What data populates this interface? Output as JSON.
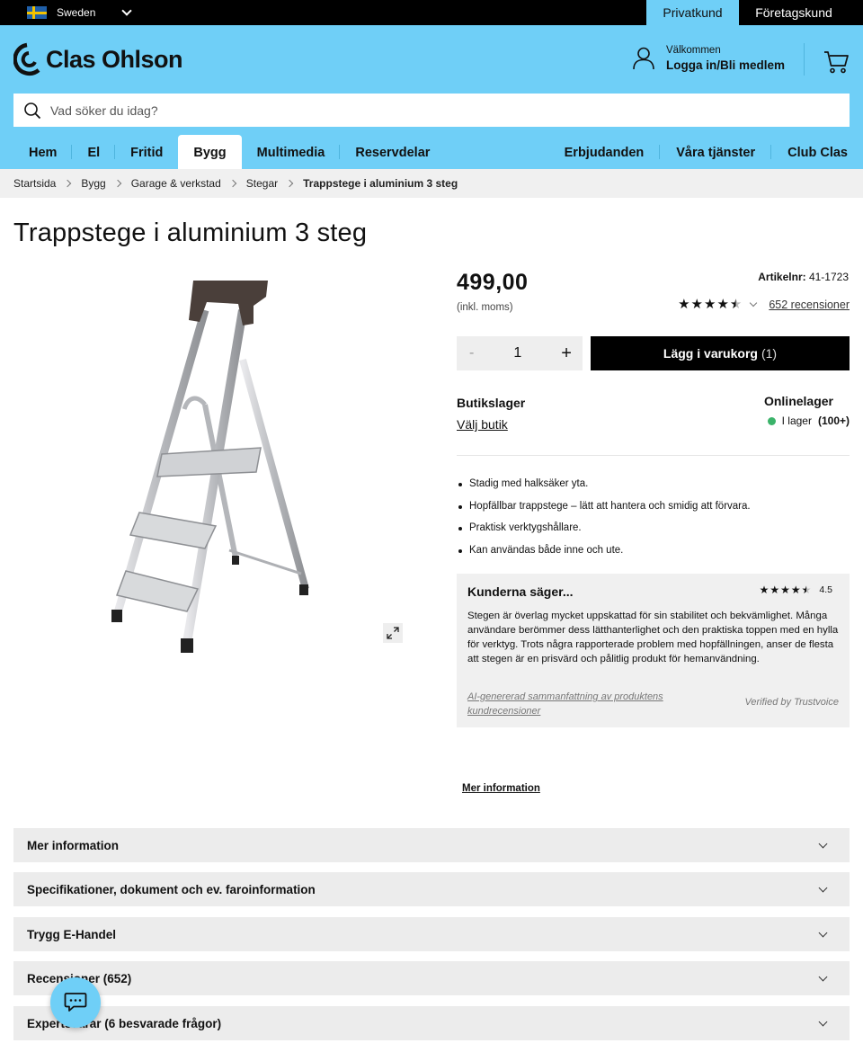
{
  "topbar": {
    "region": "Sweden",
    "private": "Privatkund",
    "business": "Företagskund"
  },
  "header": {
    "brand": "Clas Ohlson",
    "welcome": "Välkommen",
    "login": "Logga in/Bli medlem",
    "search_placeholder": "Vad söker du idag?"
  },
  "nav": {
    "left": [
      "Hem",
      "El",
      "Fritid",
      "Bygg",
      "Multimedia",
      "Reservdelar"
    ],
    "active": "Bygg",
    "right": [
      "Erbjudanden",
      "Våra tjänster",
      "Club Clas"
    ]
  },
  "breadcrumb": [
    "Startsida",
    "Bygg",
    "Garage & verkstad",
    "Stegar",
    "Trappstege i aluminium 3 steg"
  ],
  "product": {
    "title": "Trappstege i aluminium 3 steg",
    "price": "499,00",
    "vat_note": "(inkl. moms)",
    "article_label": "Artikelnr:",
    "article_number": "41-1723",
    "rating": 4.5,
    "reviews_link": "652 recensioner",
    "quantity": "1",
    "qty_minus": "-",
    "qty_plus": "+",
    "add_to_cart": "Lägg i varukorg",
    "cart_count": "(1)",
    "store_heading": "Butikslager",
    "store_link": "Välj butik",
    "online_heading": "Onlinelager",
    "stock_text": "I lager",
    "stock_count": "(100+)",
    "stock_color": "#3bb36a",
    "bullets": [
      "Stadig med halksäker yta.",
      "Hopfällbar trappstege – lätt att hantera och smidig att förvara.",
      "Praktisk verktygshållare.",
      "Kan användas både inne och ute."
    ]
  },
  "summary": {
    "heading": "Kunderna säger...",
    "score": "4.5",
    "text": "Stegen är överlag mycket uppskattad för sin stabilitet och bekvämlighet. Många användare berömmer dess lätthanterlighet och den praktiska toppen med en hylla för verktyg. Trots några rapporterade problem med hopfällningen, anser de flesta att stegen är en prisvärd och pålitlig produkt för hemanvändning.",
    "ai_note": "AI-genererad sammanfattning av produktens kundrecensioner",
    "verified": "Verified by Trustvoice"
  },
  "more_link": "Mer information",
  "accordions": [
    "Mer information",
    "Specifikationer, dokument och ev. faroinformation",
    "Trygg E-Handel",
    "Recensioner (652)",
    "Expertsvarar (6 besvarade frågor)"
  ],
  "colors": {
    "brand_blue": "#6fcff7",
    "black": "#000000"
  }
}
